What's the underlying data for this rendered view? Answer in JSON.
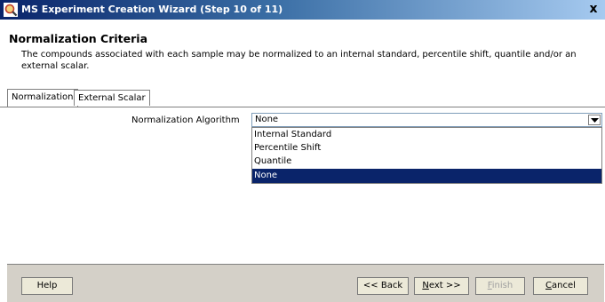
{
  "window": {
    "title": "MS Experiment Creation Wizard (Step 10 of 11)",
    "close_label": "x",
    "icon": "magnifier-icon",
    "accent": "#0a246a"
  },
  "header": {
    "title": "Normalization Criteria",
    "description": "The compounds associated with each sample may be normalized to an internal standard, percentile shift, quantile and/or an external scalar."
  },
  "tabs": [
    {
      "label": "Normalization",
      "active": true
    },
    {
      "label": "External Scalar",
      "active": false
    }
  ],
  "form": {
    "algorithm_label": "Normalization Algorithm",
    "algorithm_value": "None",
    "options": [
      {
        "label": "Internal Standard"
      },
      {
        "label": "Percentile Shift"
      },
      {
        "label": "Quantile"
      },
      {
        "label": "None",
        "selected": true
      }
    ]
  },
  "buttons": {
    "help": "Help",
    "back": "<< Back",
    "next_prefix": "",
    "next_mnemonic": "N",
    "next_rest": "ext >>",
    "finish_mnemonic": "F",
    "finish_rest": "inish",
    "cancel_mnemonic": "C",
    "cancel_rest": "ancel"
  }
}
